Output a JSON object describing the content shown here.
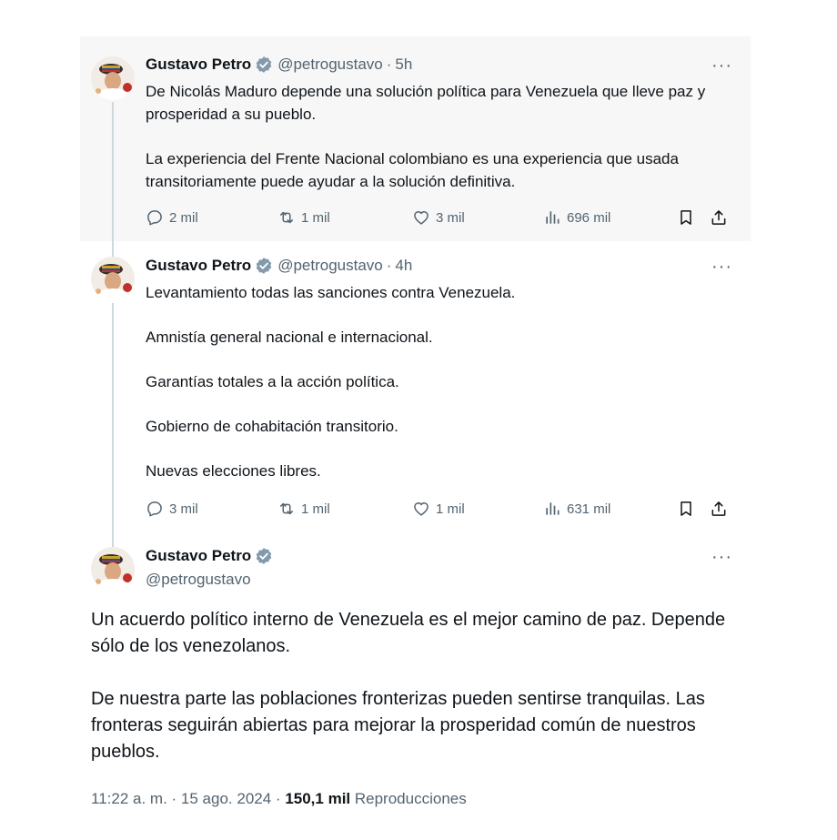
{
  "author": {
    "name": "Gustavo Petro",
    "handle": "@petrogustavo"
  },
  "thread": [
    {
      "time": "5h",
      "paragraphs": [
        "De Nicolás Maduro depende una solución política para Venezuela que lleve paz y prosperidad a su pueblo.",
        "La experiencia del Frente Nacional colombiano es una experiencia que usada transitoriamente puede ayudar a la solución definitiva."
      ],
      "stats": {
        "replies": "2 mil",
        "reposts": "1 mil",
        "likes": "3 mil",
        "views": "696 mil"
      }
    },
    {
      "time": "4h",
      "paragraphs": [
        "Levantamiento todas las sanciones contra Venezuela.",
        "Amnistía general nacional e internacional.",
        "Garantías totales a la acción política.",
        "Gobierno de cohabitación transitorio.",
        "Nuevas elecciones libres."
      ],
      "stats": {
        "replies": "3 mil",
        "reposts": "1 mil",
        "likes": "1 mil",
        "views": "631 mil"
      }
    }
  ],
  "main_tweet": {
    "paragraphs": [
      "Un acuerdo político interno de Venezuela es el mejor camino de paz. Depende sólo de los venezolanos.",
      "De nuestra parte las poblaciones fronterizas pueden sentirse tranquilas. Las fronteras seguirán abiertas para mejorar la prosperidad común de nuestros pueblos."
    ],
    "time": "11:22 a. m.",
    "date": "15 ago. 2024",
    "views_count": "150,1 mil",
    "views_label": "Reproducciones"
  },
  "icons": {
    "more": "more-options-icon",
    "verified": "verified-badge-icon",
    "reply": "reply-icon",
    "repost": "repost-icon",
    "like": "like-icon",
    "views": "views-icon",
    "bookmark": "bookmark-icon",
    "share": "share-icon"
  },
  "colors": {
    "text": "#0f1419",
    "secondary": "#536471",
    "thread_line": "#cfd9de",
    "highlight_bg": "#f7f7f7"
  }
}
